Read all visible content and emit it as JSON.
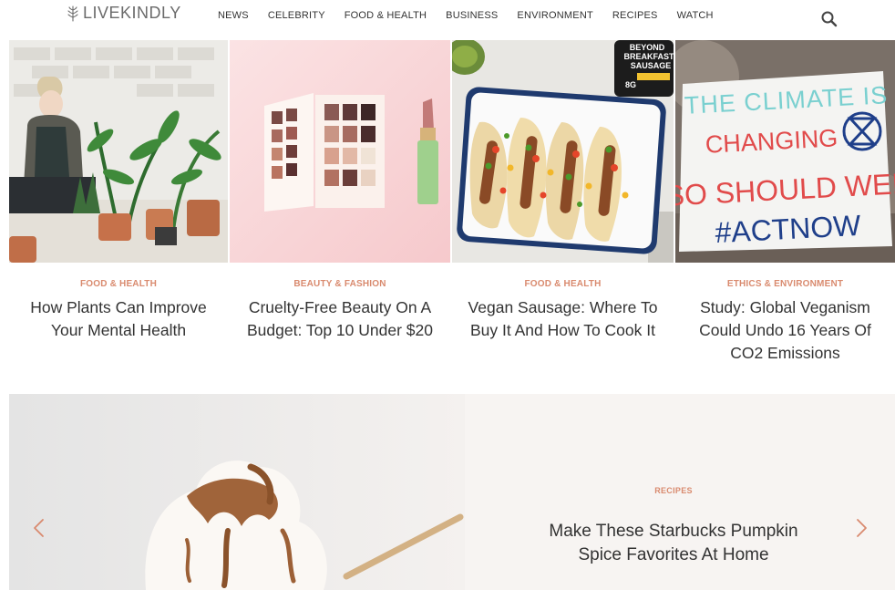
{
  "header": {
    "logo_text": "LIVEKINDLY",
    "nav": [
      "NEWS",
      "CELEBRITY",
      "FOOD & HEALTH",
      "BUSINESS",
      "ENVIRONMENT",
      "RECIPES",
      "WATCH"
    ]
  },
  "articles": [
    {
      "category": "FOOD & HEALTH",
      "title": "How Plants Can Improve Your Mental Health"
    },
    {
      "category": "BEAUTY & FASHION",
      "title": "Cruelty-Free Beauty On A Budget: Top 10 Under $20"
    },
    {
      "category": "FOOD & HEALTH",
      "title": "Vegan Sausage: Where To Buy It And How To Cook It"
    },
    {
      "category": "ETHICS & ENVIRONMENT",
      "title": "Study: Global Veganism Could Undo 16 Years Of CO2 Emissions"
    }
  ],
  "sign": {
    "line1": "THE CLIMATE IS",
    "line2": "CHANGING",
    "line3": "SO SHOULD WE!",
    "line4": "#ACTNOW"
  },
  "package": {
    "line1": "BEYOND",
    "line2": "BREAKFAST",
    "line3": "SAUSAGE",
    "line4": "8G"
  },
  "hero": {
    "category": "RECIPES",
    "title": "Make These Starbucks Pumpkin Spice Favorites At Home"
  },
  "colors": {
    "accent": "#d98a6e",
    "text": "#333333",
    "hero_bg": "#f7f4f2"
  }
}
